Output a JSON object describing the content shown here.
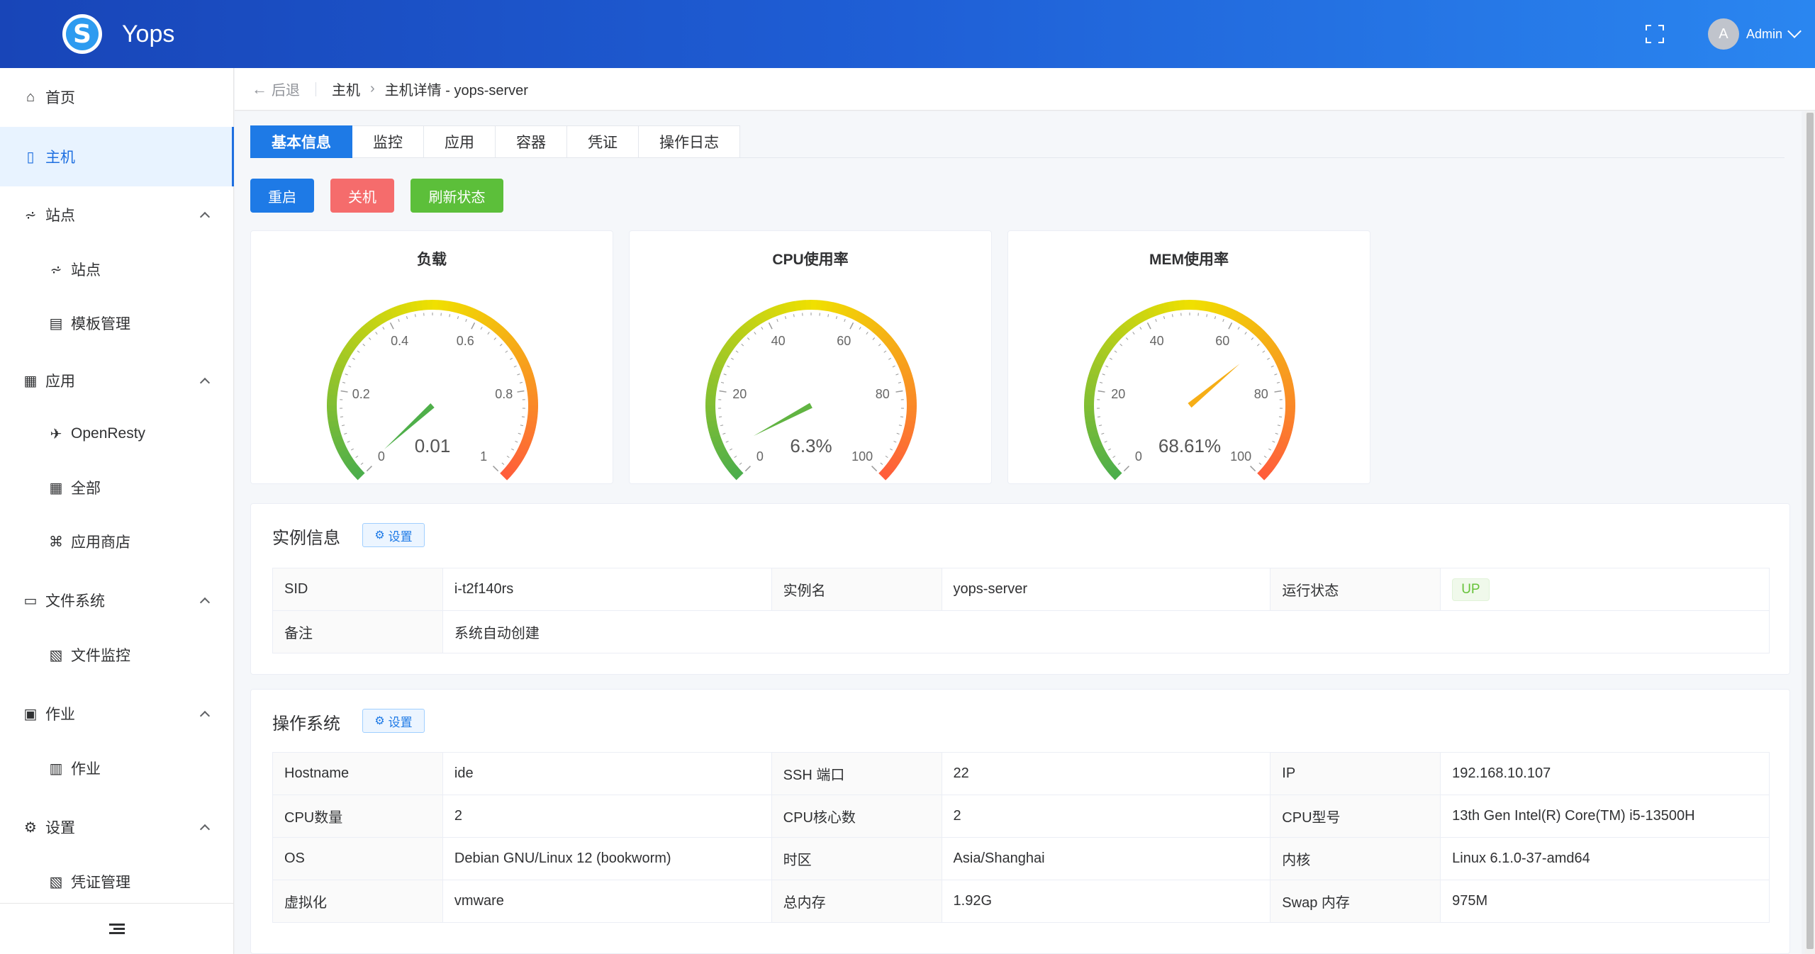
{
  "app": {
    "title": "Yops",
    "logo_letter": "S"
  },
  "user": {
    "avatar_letter": "A",
    "name": "Admin"
  },
  "sidebar": {
    "items": [
      {
        "label": "首页",
        "icon": "home-icon",
        "glyph": "⌂"
      },
      {
        "label": "主机",
        "icon": "server-icon",
        "glyph": "▯",
        "active": true
      },
      {
        "label": "站点",
        "icon": "sitemap-icon",
        "glyph": "⩫",
        "expandable": true
      },
      {
        "label": "站点",
        "icon": "sitemap-icon",
        "glyph": "⩫",
        "child": true
      },
      {
        "label": "模板管理",
        "icon": "template-icon",
        "glyph": "▤",
        "child": true
      },
      {
        "label": "应用",
        "icon": "apps-icon",
        "glyph": "▦",
        "expandable": true
      },
      {
        "label": "OpenResty",
        "icon": "openresty-icon",
        "glyph": "✈",
        "child": true
      },
      {
        "label": "全部",
        "icon": "apps-icon",
        "glyph": "▦",
        "child": true
      },
      {
        "label": "应用商店",
        "icon": "store-icon",
        "glyph": "⌘",
        "child": true
      },
      {
        "label": "文件系统",
        "icon": "folder-icon",
        "glyph": "▭",
        "expandable": true
      },
      {
        "label": "文件监控",
        "icon": "file-monitor-icon",
        "glyph": "▧",
        "child": true
      },
      {
        "label": "作业",
        "icon": "job-icon",
        "glyph": "▣",
        "expandable": true
      },
      {
        "label": "作业",
        "icon": "clipboard-icon",
        "glyph": "▥",
        "child": true
      },
      {
        "label": "设置",
        "icon": "gear-icon",
        "glyph": "⚙",
        "expandable": true
      },
      {
        "label": "凭证管理",
        "icon": "credential-icon",
        "glyph": "▧",
        "child": true
      }
    ]
  },
  "breadcrumb": {
    "back": "后退",
    "items": [
      "主机",
      "主机详情 - yops-server"
    ]
  },
  "tabs": [
    "基本信息",
    "监控",
    "应用",
    "容器",
    "凭证",
    "操作日志"
  ],
  "actions": {
    "restart": "重启",
    "shutdown": "关机",
    "refresh": "刷新状态"
  },
  "gauges": [
    {
      "title": "负载",
      "value": 0.01,
      "display": "0.01",
      "min": 0,
      "max": 1,
      "ticks": [
        "0",
        "0.2",
        "0.4",
        "0.6",
        "0.8",
        "1"
      ]
    },
    {
      "title": "CPU使用率",
      "value": 6.3,
      "display": "6.3%",
      "min": 0,
      "max": 100,
      "ticks": [
        "0",
        "20",
        "40",
        "60",
        "80",
        "100"
      ]
    },
    {
      "title": "MEM使用率",
      "value": 68.61,
      "display": "68.61%",
      "min": 0,
      "max": 100,
      "ticks": [
        "0",
        "20",
        "40",
        "60",
        "80",
        "100"
      ]
    }
  ],
  "instance": {
    "title": "实例信息",
    "set_label": "设置",
    "rows": [
      [
        {
          "label": "SID",
          "value": "i-t2f140rs"
        },
        {
          "label": "实例名",
          "value": "yops-server"
        },
        {
          "label": "运行状态",
          "value": "UP",
          "tag": true
        }
      ],
      [
        {
          "label": "备注",
          "value": "系统自动创建",
          "span": true
        }
      ]
    ]
  },
  "os": {
    "title": "操作系统",
    "set_label": "设置",
    "rows": [
      [
        {
          "label": "Hostname",
          "value": "ide"
        },
        {
          "label": "SSH 端口",
          "value": "22"
        },
        {
          "label": "IP",
          "value": "192.168.10.107"
        }
      ],
      [
        {
          "label": "CPU数量",
          "value": "2"
        },
        {
          "label": "CPU核心数",
          "value": "2"
        },
        {
          "label": "CPU型号",
          "value": "13th Gen Intel(R) Core(TM) i5-13500H"
        }
      ],
      [
        {
          "label": "OS",
          "value": "Debian GNU/Linux 12 (bookworm)"
        },
        {
          "label": "时区",
          "value": "Asia/Shanghai"
        },
        {
          "label": "内核",
          "value": "Linux 6.1.0-37-amd64"
        }
      ],
      [
        {
          "label": "虚拟化",
          "value": "vmware"
        },
        {
          "label": "总内存",
          "value": "1.92G"
        },
        {
          "label": "Swap 内存",
          "value": "975M"
        }
      ]
    ]
  },
  "colors": {
    "primary": "#1e7ae6",
    "danger": "#f56c6c",
    "success": "#5cbf3a",
    "gauge_start": "#4cae4c",
    "gauge_mid": "#f0e000",
    "gauge_end": "#ff5a3c"
  }
}
